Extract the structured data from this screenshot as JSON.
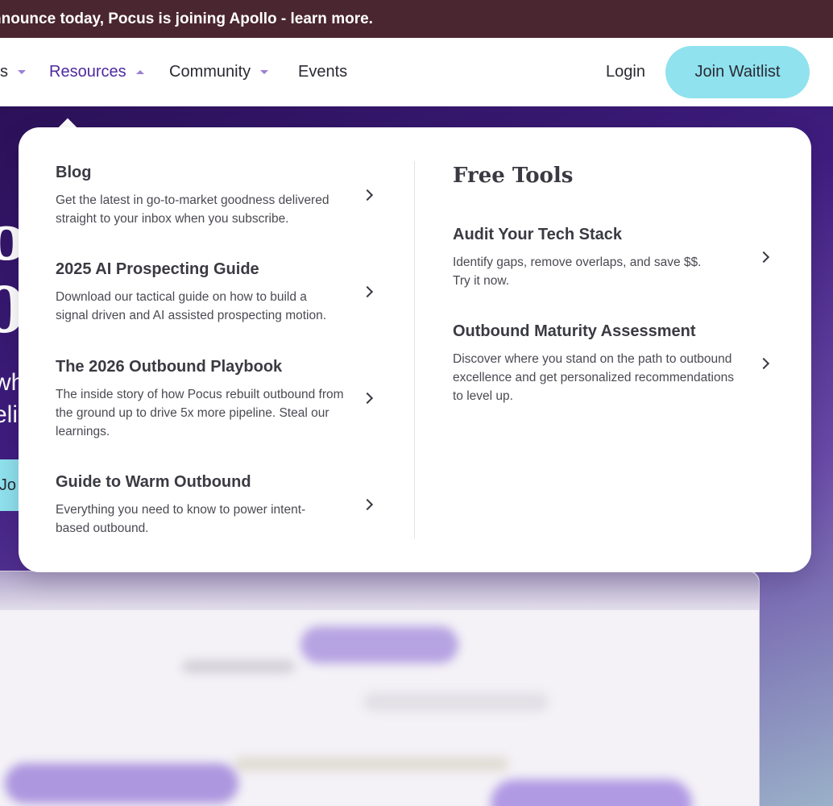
{
  "announcement": {
    "text": "nnounce today, Pocus is joining Apollo - learn more."
  },
  "nav": {
    "partial_label": "s",
    "resources_label": "Resources",
    "community_label": "Community",
    "events_label": "Events",
    "login_label": "Login",
    "waitlist_label": "Join Waitlist"
  },
  "hero": {
    "cta_label": "Jo",
    "partial_line1": "o",
    "partial_line2": "0",
    "partial_line3": "wh",
    "partial_line4": "eli"
  },
  "resources_menu": {
    "left_items": [
      {
        "title": "Blog",
        "desc": "Get the latest in go-to-market goodness delivered straight to your inbox when you subscribe."
      },
      {
        "title": "2025 AI Prospecting Guide",
        "desc": "Download our tactical guide on how to build a signal driven and AI assisted prospecting motion."
      },
      {
        "title": "The 2026 Outbound Playbook",
        "desc": "The inside story of how Pocus rebuilt outbound from the ground up to drive 5x more pipeline. Steal our learnings."
      },
      {
        "title": "Guide to Warm Outbound",
        "desc": "Everything you need to know to power intent-based outbound."
      }
    ],
    "tools_heading": "Free Tools",
    "right_items": [
      {
        "title": "Audit Your Tech Stack",
        "desc": "Identify gaps, remove overlaps, and save $$. Try it now."
      },
      {
        "title": "Outbound Maturity Assessment",
        "desc": "Discover where you stand on the path to outbound excellence and get personalized recommendations to level up."
      }
    ]
  },
  "colors": {
    "announcement_bg": "#4a2630",
    "accent_purple": "#4e2a9e",
    "waitlist_bg": "#8fe2ee",
    "hero_bg": "#3f1d80"
  }
}
